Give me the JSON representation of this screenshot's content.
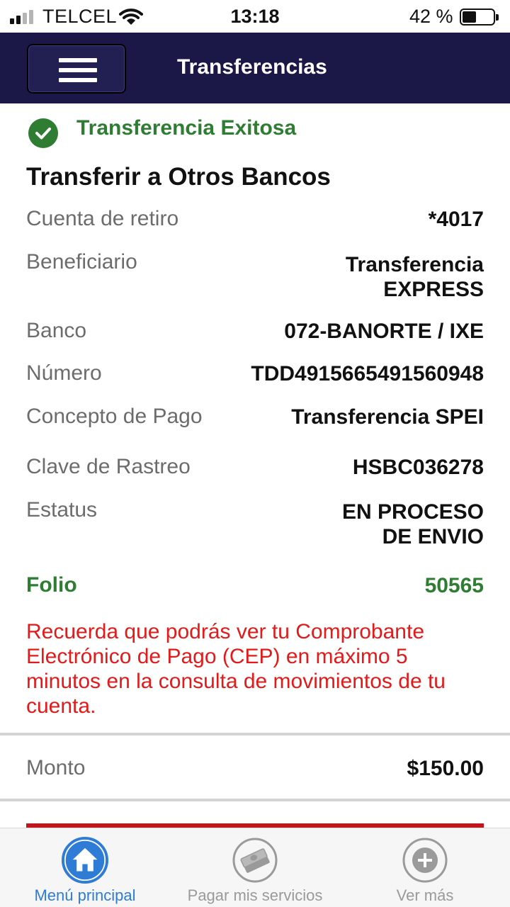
{
  "status_bar": {
    "carrier": "TELCEL",
    "time": "13:18",
    "battery": "42 %"
  },
  "header": {
    "title": "Transferencias"
  },
  "success_message": "Transferencia Exitosa",
  "section_title": "Transferir a Otros Bancos",
  "details": [
    {
      "label": "Cuenta de retiro",
      "value": "*4017"
    },
    {
      "label": "Beneficiario",
      "value": "Transferencia\nEXPRESS"
    },
    {
      "label": "Banco",
      "value": "072-BANORTE / IXE"
    },
    {
      "label": "Número",
      "value": "TDD4915665491560948"
    },
    {
      "label": "Concepto de Pago",
      "value": "Transferencia SPEI"
    },
    {
      "label": "Clave de Rastreo",
      "value": "HSBC036278"
    },
    {
      "label": "Estatus",
      "value": "EN PROCESO\nDE ENVIO"
    }
  ],
  "folio": {
    "label": "Folio",
    "value": "50565"
  },
  "notice": "Recuerda que podrás ver tu Comprobante Electrónico de Pago (CEP) en máximo 5 minutos en la consulta de movimientos de tu cuenta.",
  "amount": {
    "label": "Monto",
    "value": "$150.00"
  },
  "tabs": [
    {
      "label": "Menú principal",
      "icon": "home-icon",
      "active": true
    },
    {
      "label": "Pagar mis servicios",
      "icon": "bills-icon",
      "active": false
    },
    {
      "label": "Ver más",
      "icon": "plus-icon",
      "active": false
    }
  ],
  "colors": {
    "header_bg": "#1b1848",
    "success_green": "#2e7d32",
    "notice_red": "#e21a1a",
    "accent_blue": "#2e7cd6",
    "brand_red": "#c0161d"
  }
}
